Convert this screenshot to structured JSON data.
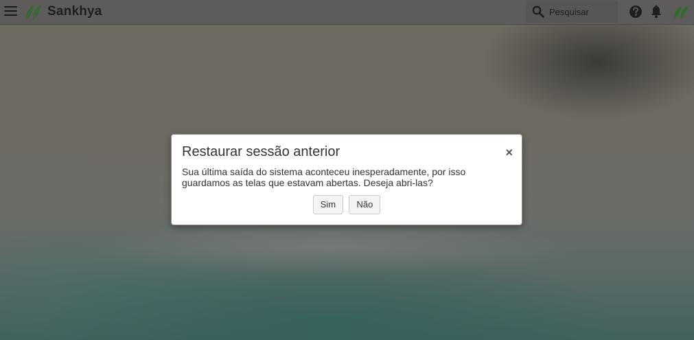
{
  "app": {
    "brand_name": "Sankhya"
  },
  "header": {
    "menu_icon": "hamburger-menu-icon",
    "search": {
      "placeholder": "Pesquisar",
      "value": "",
      "icon": "search-icon"
    },
    "help_icon": "question-circle-icon",
    "notifications_icon": "bell-icon",
    "brand_icon": "sankhya-leaf-icon"
  },
  "dialog": {
    "title": "Restaurar sessão anterior",
    "close_label": "×",
    "message_line1": "Sua última saída do sistema aconteceu inesperadamente, por isso",
    "message_line2": "guardamos as telas que estavam abertas. Deseja abri-las?",
    "buttons": {
      "yes_label": "Sim",
      "no_label": "Não"
    }
  },
  "colors": {
    "brand_green": "#2f6b2a",
    "topbar": "#5d5c5a",
    "modal_bg": "#ffffff"
  }
}
